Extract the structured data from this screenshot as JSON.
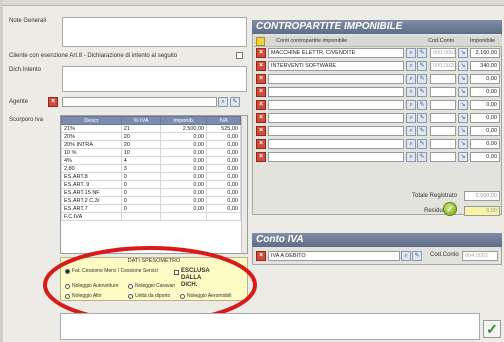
{
  "left": {
    "note_label": "Note Generali",
    "cliente_label": "Cliente con esenzione Art.8 - Dichiarazione di intento al seguito",
    "dich_label": "Dich.Intento",
    "agente_label": "Agente",
    "scorporo_label": "Scorporo Iva"
  },
  "iva_table": {
    "headers": [
      "Descr",
      "% IVA",
      "Imponib.",
      "IVA"
    ],
    "rows": [
      [
        "21%",
        "21",
        "2.500,00",
        "525,00"
      ],
      [
        "20%",
        "20",
        "0,00",
        "0,00"
      ],
      [
        "20% INTRA",
        "20",
        "0,00",
        "0,00"
      ],
      [
        "10 %",
        "10",
        "0,00",
        "0,00"
      ],
      [
        "4%",
        "4",
        "0,00",
        "0,00"
      ],
      [
        "2,80",
        "3",
        "0,00",
        "0,00"
      ],
      [
        "ES.ART.8",
        "0",
        "0,00",
        "0,00"
      ],
      [
        "ES.ART. 9",
        "0",
        "0,00",
        "0,00"
      ],
      [
        "ES.ART.15 NF",
        "0",
        "0,00",
        "0,00"
      ],
      [
        "ES.ART.2 C.3/",
        "0",
        "0,00",
        "0,00"
      ],
      [
        "ES.ART.7",
        "0",
        "0,00",
        "0,00"
      ],
      [
        "F.C.IVA",
        "",
        "",
        ""
      ]
    ]
  },
  "spesometro": {
    "title": "DATI SPESOMETRO",
    "fat_label": "Fat. Cessione Merci / Cessione Servizi",
    "esclusa_label": "ESCLUSA DALLA DICH.",
    "row2": [
      "Noleggio Autovetture",
      "Noleggio Caravan"
    ],
    "row3": [
      "Noleggio Altri",
      "Unità da diporto",
      "Noleggio Aeromobili"
    ]
  },
  "contropartite": {
    "title": "CONTROPARTITE IMPONIBILE",
    "col_conti": "Conti contropartite imponibile",
    "col_cod": "Cod.Conto",
    "col_imponibile": "Imponibile",
    "rows": [
      {
        "conto": "MACCHINE ELETTR. C/VENDITE",
        "cod": "000.0001",
        "imp": "2.160,00"
      },
      {
        "conto": "INTERVENTI SOFTWARE",
        "cod": "000.0020",
        "imp": "340,00"
      },
      {
        "conto": "",
        "cod": "",
        "imp": "0,00"
      },
      {
        "conto": "",
        "cod": "",
        "imp": "0,00"
      },
      {
        "conto": "",
        "cod": "",
        "imp": "0,00"
      },
      {
        "conto": "",
        "cod": "",
        "imp": "0,00"
      },
      {
        "conto": "",
        "cod": "",
        "imp": "0,00"
      },
      {
        "conto": "",
        "cod": "",
        "imp": "0,00"
      },
      {
        "conto": "",
        "cod": "",
        "imp": "0,00"
      }
    ],
    "totale_label": "Totale Registrato",
    "totale_value": "2.500,00",
    "residuo_label": "Residuo",
    "residuo_value": "0,00"
  },
  "conto_iva": {
    "title": "Conto IVA",
    "value": "IVA A DEBITO",
    "cod_label": "Cod.Conto",
    "cod_value": "004.0002"
  },
  "colors": {
    "highlight_ellipse": "#d81a1a",
    "spesometro_bg": "#fffbc4",
    "panel_header": "#6a7892"
  }
}
